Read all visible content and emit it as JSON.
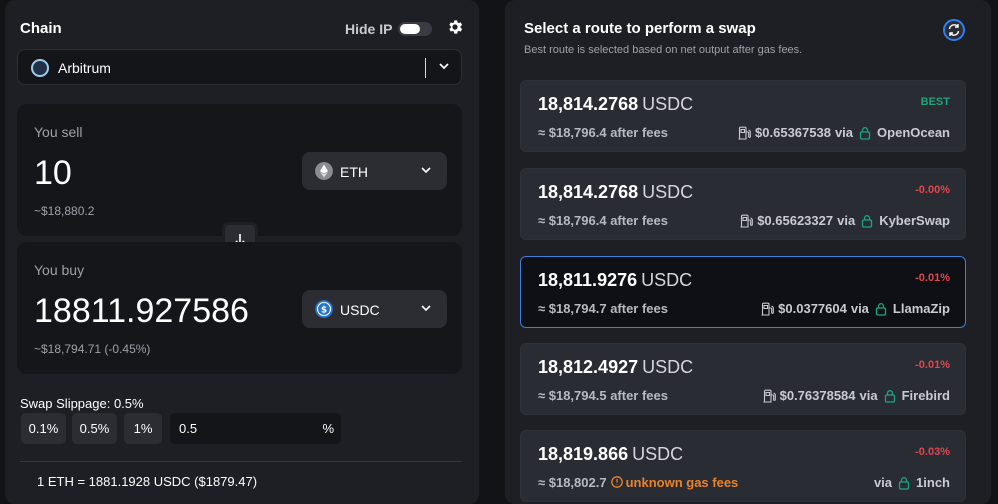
{
  "left": {
    "chain_label": "Chain",
    "hide_ip_label": "Hide IP",
    "chain": {
      "name": "Arbitrum"
    },
    "sell": {
      "label": "You sell",
      "amount": "10",
      "usd": "~$18,880.2",
      "token": "ETH"
    },
    "buy": {
      "label": "You buy",
      "amount": "18811.927586",
      "usd": "~$18,794.71 (-0.45%)",
      "token": "USDC"
    },
    "slippage": {
      "label": "Swap Slippage: 0.5%",
      "options": [
        "0.1%",
        "0.5%",
        "1%"
      ],
      "input_value": "0.5",
      "input_suffix": "%"
    },
    "rate": "1 ETH = 1881.1928 USDC ($1879.47)"
  },
  "right": {
    "title": "Select a route to perform a swap",
    "subtitle": "Best route is selected based on net output after gas fees.",
    "routes": [
      {
        "amount": "18,814.2768",
        "unit": "USDC",
        "diff": "BEST",
        "diff_color": "#1fa57a",
        "fees": "≈ $18,796.4 after fees",
        "gas": "$0.65367538",
        "via": "via",
        "dex": "OpenOcean",
        "selected": false
      },
      {
        "amount": "18,814.2768",
        "unit": "USDC",
        "diff": "-0.00%",
        "diff_color": "#e0474c",
        "fees": "≈ $18,796.4 after fees",
        "gas": "$0.65623327",
        "via": "via",
        "dex": "KyberSwap",
        "selected": false
      },
      {
        "amount": "18,811.9276",
        "unit": "USDC",
        "diff": "-0.01%",
        "diff_color": "#e0474c",
        "fees": "≈ $18,794.7 after fees",
        "gas": "$0.0377604",
        "via": "via",
        "dex": "LlamaZip",
        "selected": true
      },
      {
        "amount": "18,812.4927",
        "unit": "USDC",
        "diff": "-0.01%",
        "diff_color": "#e0474c",
        "fees": "≈ $18,794.5 after fees",
        "gas": "$0.76378584",
        "via": "via",
        "dex": "Firebird",
        "selected": false
      },
      {
        "amount": "18,819.866",
        "unit": "USDC",
        "diff": "-0.03%",
        "diff_color": "#e0474c",
        "fees": "≈ $18,802.7",
        "unknown_gas": "unknown gas fees",
        "gas": "",
        "via": "via",
        "dex": "1inch",
        "selected": false
      }
    ]
  },
  "colors": {
    "accent_green": "#1fa57a",
    "accent_red": "#e0474c",
    "accent_blue": "#3d7fd9",
    "warning_orange": "#e9822c"
  }
}
